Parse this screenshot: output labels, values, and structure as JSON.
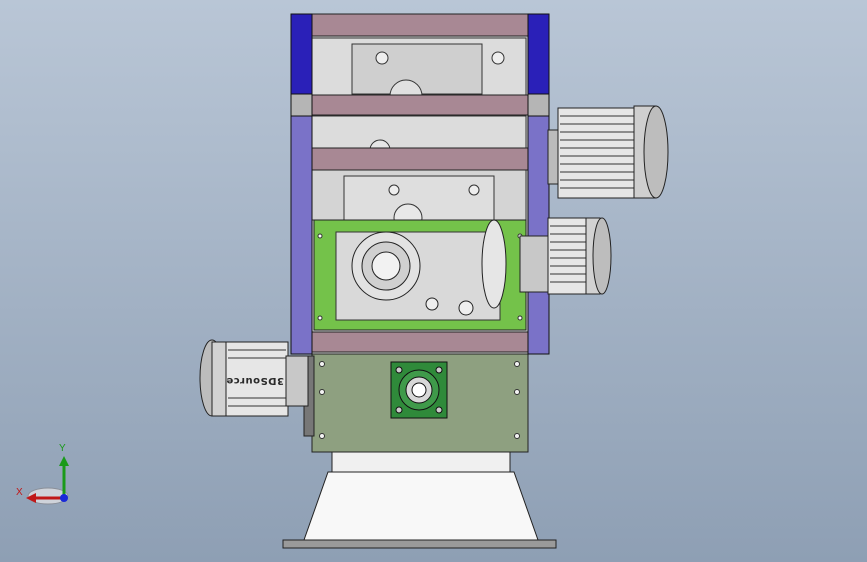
{
  "viewport": {
    "background_top": "#b9c6d6",
    "background_bottom": "#8e9fb4"
  },
  "motor": {
    "brand_label": "3DSource"
  },
  "triad": {
    "x_label": "X",
    "y_label": "Y",
    "x_color": "#c01818",
    "y_color": "#1a9a1a",
    "z_color": "#1a2ad8"
  },
  "colors": {
    "frame_blue": "#2a20b8",
    "frame_side": "#7a72c8",
    "crossbar": "#a88894",
    "gearbox_green": "#74c24a",
    "base_plate": "#8ea080",
    "bearing_green": "#2f8a3a"
  }
}
